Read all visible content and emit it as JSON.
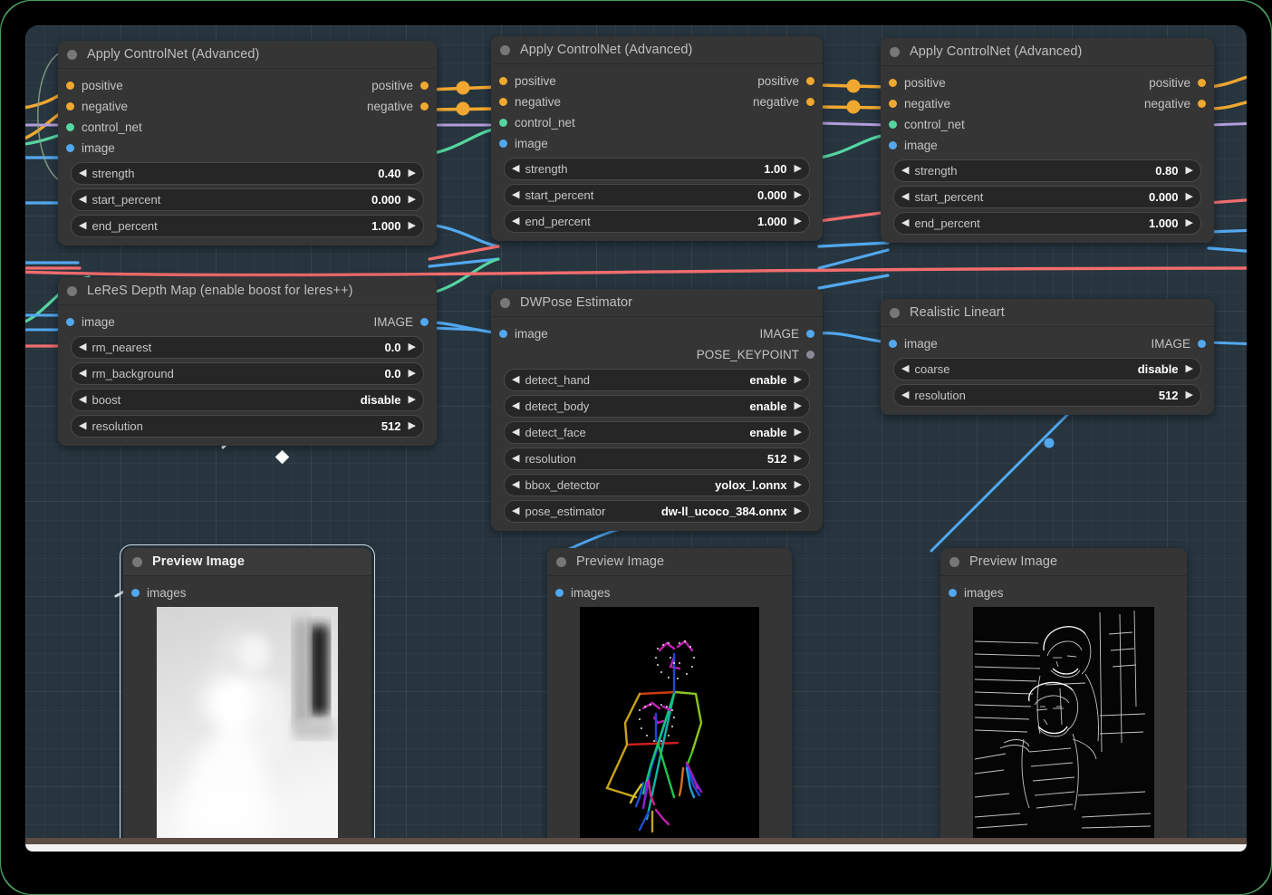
{
  "app": {
    "canvas_background": "#27353f",
    "frame_color": "#4a9c5d",
    "watermark": "comfyui-logo-watermark"
  },
  "port_colors": {
    "conditioning": "#f0a830",
    "control_net": "#55d6a0",
    "image": "#52a8ef",
    "pose_keypoint": "#8a8a9a"
  },
  "nodes": [
    {
      "id": "apply-controlnet-1",
      "title": "Apply ControlNet (Advanced)",
      "selected": false,
      "inputs": [
        {
          "name": "positive",
          "type": "conditioning"
        },
        {
          "name": "negative",
          "type": "conditioning"
        },
        {
          "name": "control_net",
          "type": "control_net"
        },
        {
          "name": "image",
          "type": "image"
        }
      ],
      "outputs": [
        {
          "name": "positive",
          "type": "conditioning"
        },
        {
          "name": "negative",
          "type": "conditioning"
        }
      ],
      "widgets": [
        {
          "name": "strength",
          "value": "0.40"
        },
        {
          "name": "start_percent",
          "value": "0.000"
        },
        {
          "name": "end_percent",
          "value": "1.000"
        }
      ]
    },
    {
      "id": "apply-controlnet-2",
      "title": "Apply ControlNet (Advanced)",
      "selected": false,
      "inputs": [
        {
          "name": "positive",
          "type": "conditioning"
        },
        {
          "name": "negative",
          "type": "conditioning"
        },
        {
          "name": "control_net",
          "type": "control_net"
        },
        {
          "name": "image",
          "type": "image"
        }
      ],
      "outputs": [
        {
          "name": "positive",
          "type": "conditioning"
        },
        {
          "name": "negative",
          "type": "conditioning"
        }
      ],
      "widgets": [
        {
          "name": "strength",
          "value": "1.00"
        },
        {
          "name": "start_percent",
          "value": "0.000"
        },
        {
          "name": "end_percent",
          "value": "1.000"
        }
      ]
    },
    {
      "id": "apply-controlnet-3",
      "title": "Apply ControlNet (Advanced)",
      "selected": false,
      "inputs": [
        {
          "name": "positive",
          "type": "conditioning"
        },
        {
          "name": "negative",
          "type": "conditioning"
        },
        {
          "name": "control_net",
          "type": "control_net"
        },
        {
          "name": "image",
          "type": "image"
        }
      ],
      "outputs": [
        {
          "name": "positive",
          "type": "conditioning"
        },
        {
          "name": "negative",
          "type": "conditioning"
        }
      ],
      "widgets": [
        {
          "name": "strength",
          "value": "0.80"
        },
        {
          "name": "start_percent",
          "value": "0.000"
        },
        {
          "name": "end_percent",
          "value": "1.000"
        }
      ]
    },
    {
      "id": "leres-depth-map",
      "title": "LeReS Depth Map (enable boost for leres++)",
      "selected": false,
      "inputs": [
        {
          "name": "image",
          "type": "image"
        }
      ],
      "outputs": [
        {
          "name": "IMAGE",
          "type": "image"
        }
      ],
      "widgets": [
        {
          "name": "rm_nearest",
          "value": "0.0"
        },
        {
          "name": "rm_background",
          "value": "0.0"
        },
        {
          "name": "boost",
          "value": "disable"
        },
        {
          "name": "resolution",
          "value": "512"
        }
      ]
    },
    {
      "id": "dwpose-estimator",
      "title": "DWPose Estimator",
      "selected": false,
      "inputs": [
        {
          "name": "image",
          "type": "image"
        }
      ],
      "outputs": [
        {
          "name": "IMAGE",
          "type": "image"
        },
        {
          "name": "POSE_KEYPOINT",
          "type": "pose_keypoint"
        }
      ],
      "widgets": [
        {
          "name": "detect_hand",
          "value": "enable"
        },
        {
          "name": "detect_body",
          "value": "enable"
        },
        {
          "name": "detect_face",
          "value": "enable"
        },
        {
          "name": "resolution",
          "value": "512"
        },
        {
          "name": "bbox_detector",
          "value": "yolox_l.onnx"
        },
        {
          "name": "pose_estimator",
          "value": "dw-ll_ucoco_384.onnx"
        }
      ]
    },
    {
      "id": "realistic-lineart",
      "title": "Realistic Lineart",
      "selected": false,
      "inputs": [
        {
          "name": "image",
          "type": "image"
        }
      ],
      "outputs": [
        {
          "name": "IMAGE",
          "type": "image"
        }
      ],
      "widgets": [
        {
          "name": "coarse",
          "value": "disable"
        },
        {
          "name": "resolution",
          "value": "512"
        }
      ]
    },
    {
      "id": "preview-image-depth",
      "title": "Preview Image",
      "selected": true,
      "inputs": [
        {
          "name": "images",
          "type": "image"
        }
      ],
      "outputs": [],
      "widgets": [],
      "preview": "depth-map-grayscale"
    },
    {
      "id": "preview-image-pose",
      "title": "Preview Image",
      "selected": false,
      "inputs": [
        {
          "name": "images",
          "type": "image"
        }
      ],
      "outputs": [],
      "widgets": [],
      "preview": "openpose-skeleton"
    },
    {
      "id": "preview-image-lineart",
      "title": "Preview Image",
      "selected": false,
      "inputs": [
        {
          "name": "images",
          "type": "image"
        }
      ],
      "outputs": [],
      "widgets": [],
      "preview": "lineart-edges"
    }
  ]
}
